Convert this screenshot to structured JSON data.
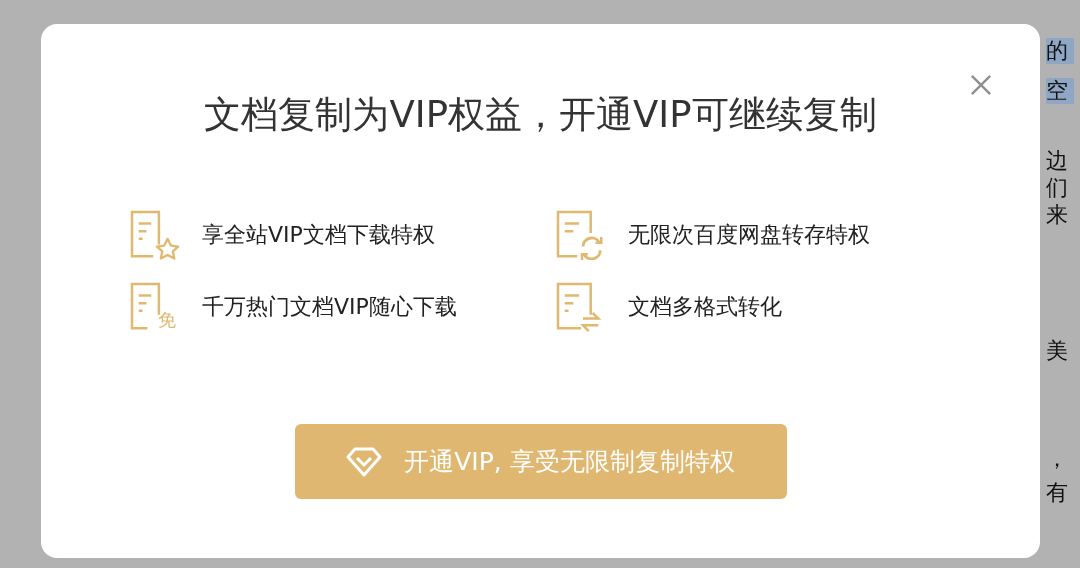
{
  "document": {
    "lines": [
      {
        "text": "的",
        "highlighted": true
      },
      {
        "text": "空",
        "highlighted": true
      },
      {
        "text": "边",
        "highlighted": false
      },
      {
        "text": "们",
        "highlighted": false
      },
      {
        "text": "来",
        "highlighted": false
      },
      {
        "text": "美",
        "highlighted": false
      },
      {
        "text": "，",
        "highlighted": false
      },
      {
        "text": "有",
        "highlighted": false
      }
    ]
  },
  "dialog": {
    "title": "文档复制为VIP权益，开通VIP可继续复制",
    "features": [
      {
        "kind": "star",
        "label": "享全站VIP文档下载特权"
      },
      {
        "kind": "sync",
        "label": "无限次百度网盘转存特权"
      },
      {
        "kind": "free",
        "badge": "免",
        "label": "千万热门文档VIP随心下载"
      },
      {
        "kind": "convert",
        "label": "文档多格式转化"
      }
    ],
    "button": "开通VIP, 享受无限制复制特权"
  }
}
